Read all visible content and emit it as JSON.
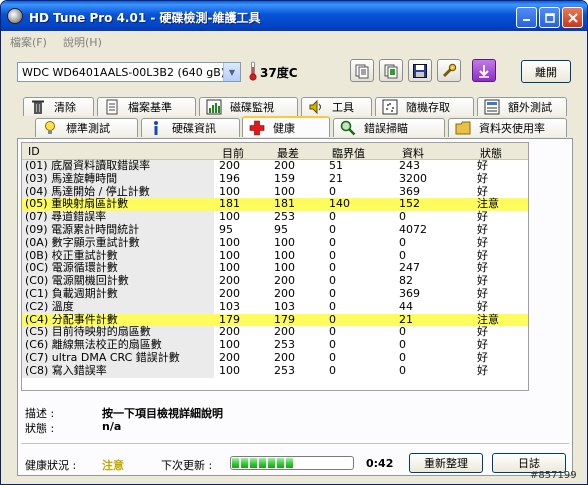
{
  "window": {
    "title": "HD Tune Pro 4.01 - 硬碟檢測-維護工具"
  },
  "menu": {
    "items": [
      "檔案(F)",
      "說明(H)"
    ]
  },
  "drive": {
    "selected": "WDC WD6401AALS-00L3B2 (640 gB)",
    "temperature": "37度C"
  },
  "toolbar": {
    "exit_label": "離開"
  },
  "tabs_row1": [
    {
      "label": "清除",
      "icon": "trash-icon"
    },
    {
      "label": "檔案基準",
      "icon": "file-benchmark-icon"
    },
    {
      "label": "磁碟監視",
      "icon": "disk-monitor-icon"
    },
    {
      "label": "工具",
      "icon": "speaker-tool-icon"
    },
    {
      "label": "隨機存取",
      "icon": "random-access-icon"
    },
    {
      "label": "額外測試",
      "icon": "extra-tests-icon"
    }
  ],
  "tabs_row2": [
    {
      "label": "標準測試",
      "icon": "bulb-icon"
    },
    {
      "label": "硬碟資訊",
      "icon": "info-icon"
    },
    {
      "label": "健康",
      "icon": "health-cross-icon",
      "active": true
    },
    {
      "label": "錯誤掃瞄",
      "icon": "magnifier-icon"
    },
    {
      "label": "資料夾使用率",
      "icon": "folder-icon"
    }
  ],
  "table": {
    "headers": [
      "ID",
      "目前",
      "最差",
      "臨界值",
      "資料",
      "狀態"
    ],
    "rows": [
      {
        "id": "(01) 底層資料讀取錯誤率",
        "current": "200",
        "worst": "200",
        "threshold": "51",
        "data": "243",
        "status": "好",
        "warn": false
      },
      {
        "id": "(03) 馬達旋轉時間",
        "current": "196",
        "worst": "159",
        "threshold": "21",
        "data": "3200",
        "status": "好",
        "warn": false
      },
      {
        "id": "(04) 馬達開始 / 停止計數",
        "current": "100",
        "worst": "100",
        "threshold": "0",
        "data": "369",
        "status": "好",
        "warn": false
      },
      {
        "id": "(05) 重映射扇區計數",
        "current": "181",
        "worst": "181",
        "threshold": "140",
        "data": "152",
        "status": "注意",
        "warn": true
      },
      {
        "id": "(07) 尋道錯誤率",
        "current": "100",
        "worst": "253",
        "threshold": "0",
        "data": "0",
        "status": "好",
        "warn": false
      },
      {
        "id": "(09) 電源累計時間統計",
        "current": "95",
        "worst": "95",
        "threshold": "0",
        "data": "4072",
        "status": "好",
        "warn": false
      },
      {
        "id": "(0A) 數字顯示重試計數",
        "current": "100",
        "worst": "100",
        "threshold": "0",
        "data": "0",
        "status": "好",
        "warn": false
      },
      {
        "id": "(0B) 校正重試計數",
        "current": "100",
        "worst": "100",
        "threshold": "0",
        "data": "0",
        "status": "好",
        "warn": false
      },
      {
        "id": "(0C) 電源循環計數",
        "current": "100",
        "worst": "100",
        "threshold": "0",
        "data": "247",
        "status": "好",
        "warn": false
      },
      {
        "id": "(C0) 電源關機回計數",
        "current": "200",
        "worst": "200",
        "threshold": "0",
        "data": "82",
        "status": "好",
        "warn": false
      },
      {
        "id": "(C1) 負載週期計數",
        "current": "200",
        "worst": "200",
        "threshold": "0",
        "data": "369",
        "status": "好",
        "warn": false
      },
      {
        "id": "(C2) 溫度",
        "current": "103",
        "worst": "103",
        "threshold": "0",
        "data": "44",
        "status": "好",
        "warn": false
      },
      {
        "id": "(C4) 分配事件計數",
        "current": "179",
        "worst": "179",
        "threshold": "0",
        "data": "21",
        "status": "注意",
        "warn": true
      },
      {
        "id": "(C5) 目前待映射的扇區數",
        "current": "200",
        "worst": "200",
        "threshold": "0",
        "data": "0",
        "status": "好",
        "warn": false
      },
      {
        "id": "(C6) 離線無法校正的扇區數",
        "current": "100",
        "worst": "253",
        "threshold": "0",
        "data": "0",
        "status": "好",
        "warn": false
      },
      {
        "id": "(C7) ultra DMA CRC 錯誤計數",
        "current": "200",
        "worst": "200",
        "threshold": "0",
        "data": "0",
        "status": "好",
        "warn": false
      },
      {
        "id": "(C8) 寫入錯誤率",
        "current": "100",
        "worst": "253",
        "threshold": "0",
        "data": "0",
        "status": "好",
        "warn": false
      }
    ]
  },
  "detail": {
    "description_label": "描述 :",
    "description_value": "按一下項目檢視詳細說明",
    "status_label": "狀態 :",
    "status_value": "n/a"
  },
  "footer": {
    "health_label": "健康狀況 :",
    "health_value": "注意",
    "next_update_label": "下次更新 :",
    "countdown": "0:42",
    "progress_fraction": 0.55,
    "refresh_label": "重新整理",
    "log_label": "日誌"
  },
  "watermark": "#857199",
  "colors": {
    "warn_row": "#fdfc5c",
    "health_warn_text": "#c0a800"
  }
}
